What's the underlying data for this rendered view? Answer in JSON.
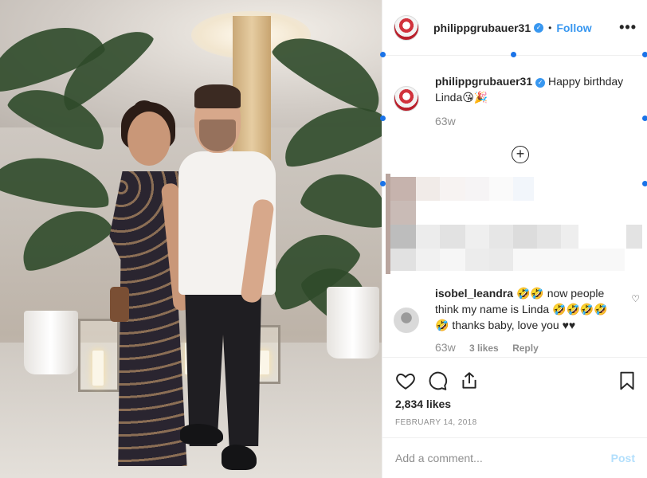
{
  "post": {
    "author": "philippgrubauer31",
    "follow_label": "Follow",
    "more_label": "•••",
    "caption": {
      "username": "philippgrubauer31",
      "text": "Happy birthday Linda😘🎉",
      "time": "63w"
    },
    "load_more_label": "+",
    "comments": [
      {
        "username": "isobel_leandra",
        "text": "🤣🤣 now people think my name is Linda 🤣🤣🤣🤣🤣 thanks baby, love you ♥♥",
        "time": "63w",
        "likes": "3 likes",
        "reply_label": "Reply"
      }
    ],
    "likes": "2,834 likes",
    "date": "FEBRUARY 14, 2018",
    "add_comment_placeholder": "Add a comment...",
    "post_label": "Post"
  },
  "icons": {
    "like": "heart-icon",
    "comment": "comment-icon",
    "share": "share-icon",
    "save": "bookmark-icon"
  },
  "colors": {
    "link_blue": "#3897f0",
    "post_disabled": "#b2dffc",
    "muted": "#8e8e8e",
    "text": "#262626",
    "selection_handle": "#1a73e8"
  }
}
